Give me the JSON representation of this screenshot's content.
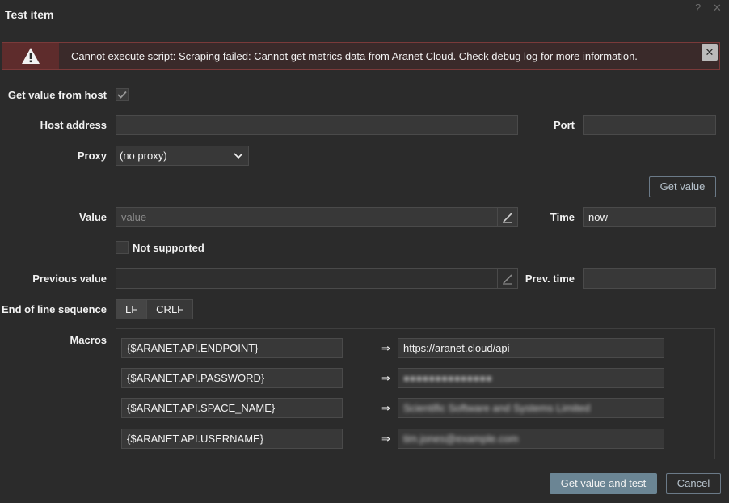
{
  "dialog": {
    "title": "Test item",
    "help_icon": "?",
    "close_icon": "✕"
  },
  "alert": {
    "message": "Cannot execute script: Scraping failed: Cannot get metrics data from Aranet Cloud. Check debug log for more information.",
    "close_glyph": "✕"
  },
  "form": {
    "get_value_from_host_label": "Get value from host",
    "get_value_from_host_checked": true,
    "host_address_label": "Host address",
    "host_address_value": "",
    "port_label": "Port",
    "port_value": "",
    "proxy_label": "Proxy",
    "proxy_value": "(no proxy)",
    "get_value_button": "Get value",
    "value_label": "Value",
    "value_placeholder": "value",
    "time_label": "Time",
    "time_value": "now",
    "not_supported_label": "Not supported",
    "previous_value_label": "Previous value",
    "previous_value": "",
    "prev_time_label": "Prev. time",
    "prev_time_value": "",
    "eol_label": "End of line sequence",
    "eol_options": [
      "LF",
      "CRLF"
    ],
    "eol_selected": "LF",
    "macros_label": "Macros",
    "macro_arrow": "⇒",
    "macros": [
      {
        "name": "{$ARANET.API.ENDPOINT}",
        "value": "https://aranet.cloud/api",
        "blurred": false
      },
      {
        "name": "{$ARANET.API.PASSWORD}",
        "value": "●●●●●●●●●●●●●●",
        "blurred": true
      },
      {
        "name": "{$ARANET.API.SPACE_NAME}",
        "value": "Scientific Software and Systems Limited",
        "blurred": true
      },
      {
        "name": "{$ARANET.API.USERNAME}",
        "value": "tim.jones@example.com",
        "blurred": true
      }
    ]
  },
  "footer": {
    "test_button": "Get value and test",
    "cancel_button": "Cancel"
  }
}
